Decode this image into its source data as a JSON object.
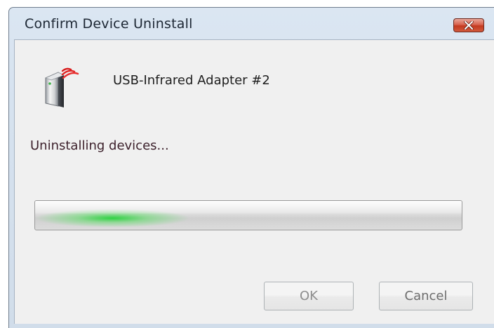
{
  "window": {
    "title": "Confirm Device Uninstall"
  },
  "device": {
    "name": "USB-Infrared Adapter #2",
    "icon": "infrared-device-icon"
  },
  "status": {
    "text": "Uninstalling devices..."
  },
  "progress": {
    "style": "marquee-indeterminate",
    "glow_color": "#2ed23e"
  },
  "buttons": {
    "ok_label": "OK",
    "cancel_label": "Cancel"
  },
  "colors": {
    "close_button": "#d25a3e",
    "client_background": "#f0f0f0"
  }
}
